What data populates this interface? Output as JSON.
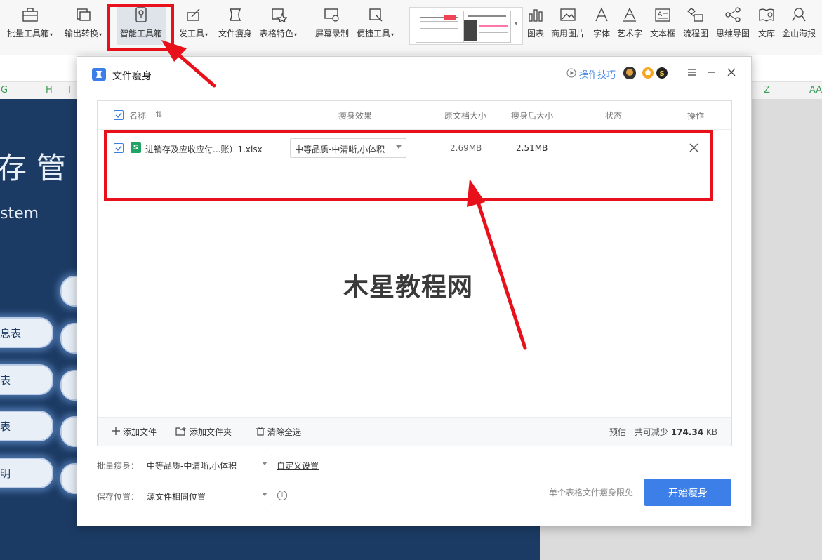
{
  "toolbar": {
    "items": [
      {
        "label": "批量工具箱",
        "caret": true
      },
      {
        "label": "输出转换",
        "caret": true
      },
      {
        "label": "智能工具箱",
        "caret": false
      },
      {
        "label": "发工具",
        "caret": true
      },
      {
        "label": "文件瘦身",
        "caret": false
      },
      {
        "label": "表格特色",
        "caret": true
      },
      {
        "label": "屏幕录制",
        "caret": false
      },
      {
        "label": "便捷工具",
        "caret": true
      },
      {
        "label": "图表",
        "caret": false
      },
      {
        "label": "商用图片",
        "caret": false
      },
      {
        "label": "字体",
        "caret": false
      },
      {
        "label": "艺术字",
        "caret": false
      },
      {
        "label": "文本框",
        "caret": false
      },
      {
        "label": "流程图",
        "caret": false
      },
      {
        "label": "思维导图",
        "caret": false
      },
      {
        "label": "文库",
        "caret": false
      },
      {
        "label": "金山海报",
        "caret": false
      }
    ],
    "caret_glyph": "▾"
  },
  "sheet": {
    "columns": [
      "G",
      "H",
      "I",
      "Z",
      "AA"
    ],
    "title": "存管理",
    "subtitle": "stem",
    "pills": [
      "息表",
      "表",
      "表",
      "明"
    ]
  },
  "dialog": {
    "title": "文件瘦身",
    "tips_label": "操作技巧",
    "headers": {
      "name": "名称",
      "sort": "⇅",
      "effect": "瘦身效果",
      "orig_size": "原文档大小",
      "new_size": "瘦身后大小",
      "status": "状态",
      "action": "操作"
    },
    "file": {
      "icon_letter": "S",
      "name": "进销存及应收应付...账）1.xlsx",
      "quality": "中等品质-中清晰,小体积",
      "orig_size": "2.69MB",
      "new_size": "2.51MB"
    },
    "watermark": "木星教程网",
    "footer": {
      "add_file": "添加文件",
      "add_folder": "添加文件夹",
      "clear_all": "清除全选",
      "estimate_label": "预估一共可减少",
      "estimate_value": "174.34",
      "estimate_unit": "KB"
    },
    "batch_label": "批量瘦身：",
    "batch_value": "中等品质-中清晰,小体积",
    "custom_link": "自定义设置",
    "save_label": "保存位置：",
    "save_value": "源文件相同位置",
    "free_note": "单个表格文件瘦身限免",
    "start_button": "开始瘦身"
  },
  "colors": {
    "accent": "#3d7fe8",
    "annotation_red": "#e8101a",
    "sheet_navy": "#1c3b64",
    "excel_green": "#21a366"
  }
}
